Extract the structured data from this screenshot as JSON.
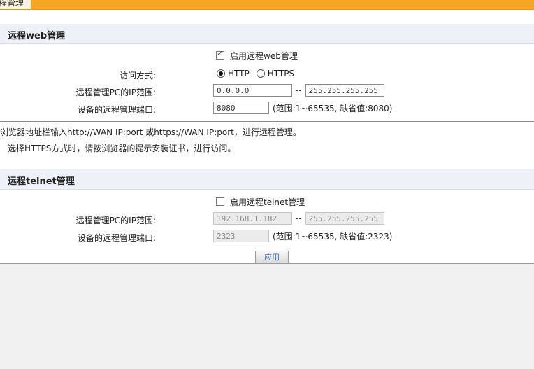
{
  "page_tab": "远程管理",
  "web_section": {
    "title": "远程web管理",
    "enable_label": "启用远程web管理",
    "enable_checked": true,
    "access_label": "访问方式:",
    "http_label": "HTTP",
    "https_label": "HTTPS",
    "selected": "HTTP",
    "ip_range_label": "远程管理PC的IP范围:",
    "ip_start": "0.0.0.0",
    "ip_end": "255.255.255.255",
    "range_sep": "--",
    "port_label": "设备的远程管理端口:",
    "port_value": "8080",
    "port_hint": "(范围:1~65535, 缺省值:8080)"
  },
  "notes": [
    "在浏览器地址栏输入http://WAN IP:port 或https://WAN IP:port，进行远程管理。",
    "选择HTTPS方式时，请按浏览器的提示安装证书，进行访问。"
  ],
  "telnet_section": {
    "title": "远程telnet管理",
    "enable_label": "启用远程telnet管理",
    "enable_checked": false,
    "ip_range_label": "远程管理PC的IP范围:",
    "ip_start": "192.168.1.182",
    "ip_end": "255.255.255.255",
    "range_sep": "--",
    "port_label": "设备的远程管理端口:",
    "port_value": "2323",
    "port_hint": "(范围:1~65535, 缺省值:2323)"
  },
  "apply_label": "应用",
  "colors": {
    "tab_bar": "#f5a623",
    "section_header": "#eef2f8",
    "link_text": "#3b6bb5"
  }
}
